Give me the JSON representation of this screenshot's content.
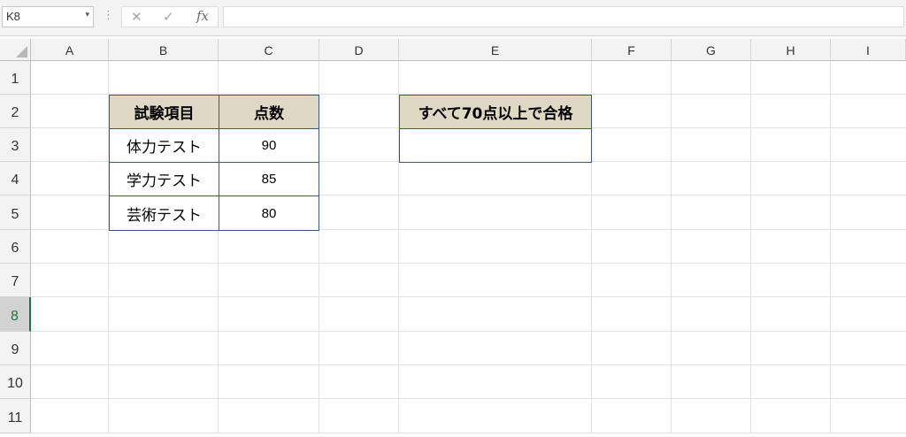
{
  "formula_bar": {
    "name_box": "K8",
    "name_box_arrow": "▾",
    "separator": "⋮",
    "cancel_glyph": "✕",
    "enter_glyph": "✓",
    "fx_label": "fx",
    "formula": ""
  },
  "columns": [
    "A",
    "B",
    "C",
    "D",
    "E",
    "F",
    "G",
    "H",
    "I"
  ],
  "rows": [
    "1",
    "2",
    "3",
    "4",
    "5",
    "6",
    "7",
    "8",
    "9",
    "10",
    "11"
  ],
  "selected_row": "8",
  "score_table": {
    "header": {
      "item": "試験項目",
      "score": "点数"
    },
    "rows": [
      {
        "item": "体力テスト",
        "score": "90"
      },
      {
        "item": "学力テスト",
        "score": "85"
      },
      {
        "item": "芸術テスト",
        "score": "80"
      }
    ]
  },
  "result_table": {
    "header": "すべて70点以上で合格",
    "value": ""
  },
  "colors": {
    "header_fill": "#ddd9c4",
    "table_border": "#3a5683",
    "selection_accent": "#217346"
  }
}
